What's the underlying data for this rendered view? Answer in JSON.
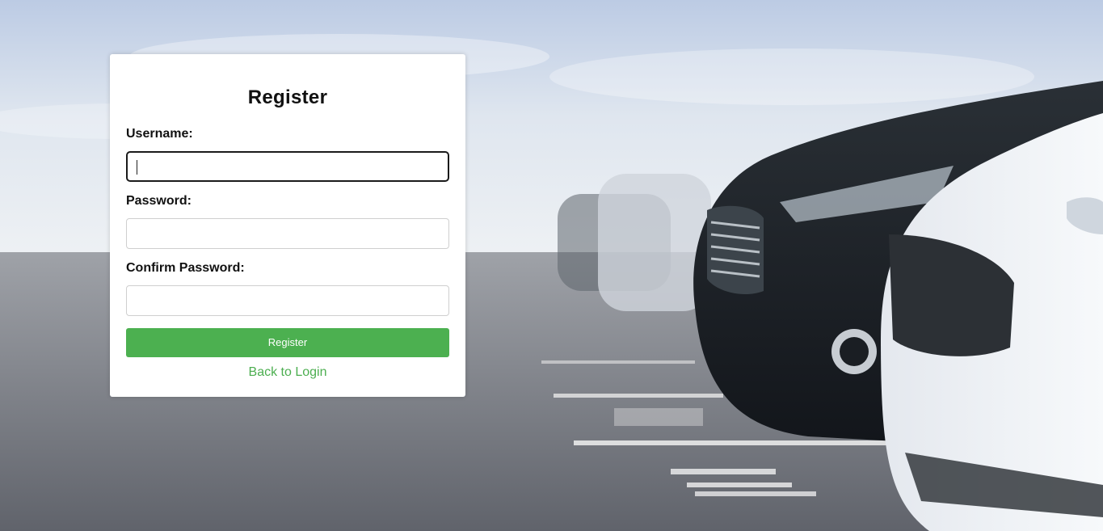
{
  "form": {
    "title": "Register",
    "username_label": "Username:",
    "username_value": "",
    "password_label": "Password:",
    "password_value": "",
    "confirm_label": "Confirm Password:",
    "confirm_value": "",
    "submit_label": "Register",
    "back_link": "Back to Login"
  },
  "colors": {
    "accent": "#4cb050",
    "link": "#4cae50",
    "card": "#ffffff"
  }
}
